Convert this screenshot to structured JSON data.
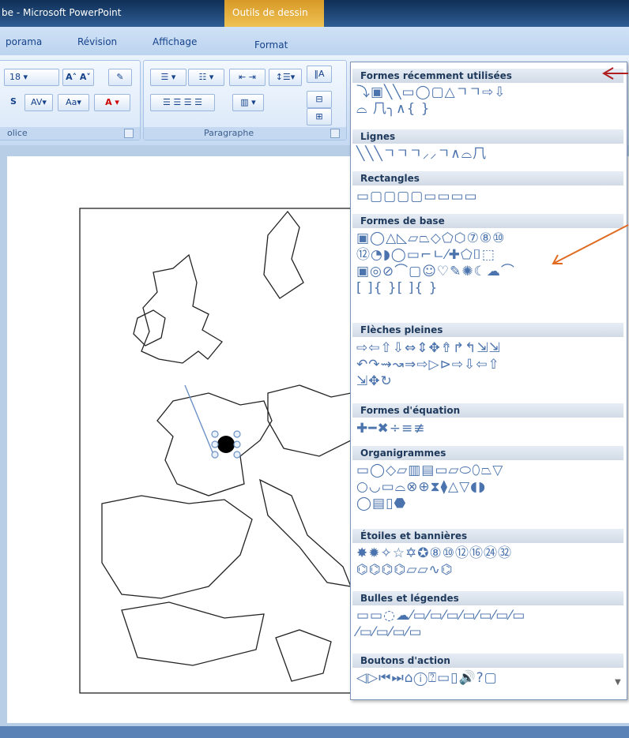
{
  "window": {
    "title": "be - Microsoft PowerPoint",
    "context_tab": "Outils de dessin"
  },
  "tabs": {
    "items": [
      "porama",
      "Révision",
      "Affichage"
    ],
    "context": "Format"
  },
  "ribbon": {
    "font_size": "18",
    "font_group_label": "olice",
    "paragraph_group_label": "Paragraphe",
    "aa_label": "Aa",
    "s_label": "S",
    "av_label": "AV"
  },
  "gallery": {
    "sections": [
      {
        "title": "Formes récemment utilisées",
        "rows": [
          "⤵▣╲╲▭◯▢△ㄱㄱ⇨⇩",
          "⌓ ⺇╮∧{ }"
        ]
      },
      {
        "title": "Lignes",
        "rows": [
          "╲╲╲ㄱㄱㄱ⸝⸝ㄱ∧⌓⺇"
        ]
      },
      {
        "title": "Rectangles",
        "rows": [
          "▭▢▢▢▢▭▭▭▭"
        ]
      },
      {
        "title": "Formes de base",
        "rows": [
          "▣◯△◺▱⏢◇⬠⬡⑦⑧⑩",
          "⑫◔◗◯▭⌐ㄴ⁄✚⬠⌷⬚",
          "▣◎⊘⌒▢☺♡✎✺☾☁⌒",
          "[ ]{ }[ ]{ }"
        ]
      },
      {
        "title": "Flèches pleines",
        "rows": [
          "⇨⇦⇧⇩⇔⇕✥⇮↱↰⇲⇲",
          "↶↷⇝↝⇒⇨▷⊳⇨⇩⇦⇧",
          "⇲✥↻"
        ]
      },
      {
        "title": "Formes d'équation",
        "rows": [
          "✚━✖÷≡≢"
        ]
      },
      {
        "title": "Organigrammes",
        "rows": [
          "▭◯◇▱▥▤▭▱⬭⬯⏢▽",
          "○◡▭⌓⊗⊕⧗⧫△▽◖◗",
          "◯▤▯⬣"
        ]
      },
      {
        "title": "Étoiles et bannières",
        "rows": [
          "✸✹✧☆✡✪⑧⑩⑫⑯㉔㉜",
          "⌬⌬⌬⌬▱▱∿⌬"
        ]
      },
      {
        "title": "Bulles et légendes",
        "rows": [
          "▭▭◌☁⁄▭⁄▭⁄▭⁄▭⁄▭⁄▭⁄▭",
          "⁄▭⁄▭⁄▭⁄▭"
        ]
      },
      {
        "title": "Boutons d'action",
        "rows": [
          "◁▷⏮⏭⌂ⓘ⍰▭▯🔊?▢"
        ]
      }
    ]
  },
  "colors": {
    "title_bg": "#1d4577",
    "context_tab": "#e5ae3f",
    "ribbon": "#d6e5f7",
    "section_header": "#dde5ef",
    "icon": "#4b73ad"
  }
}
